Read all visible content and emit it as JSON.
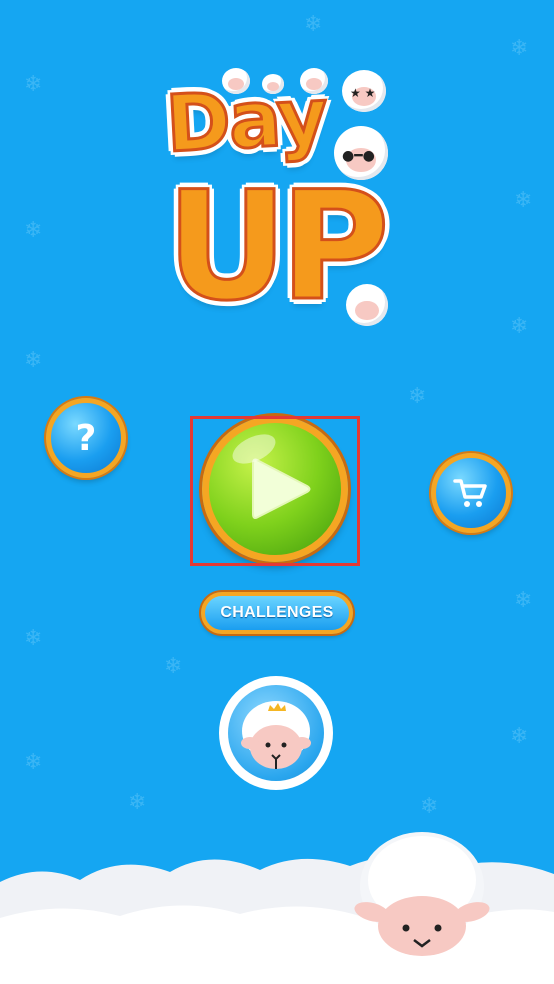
{
  "logo": {
    "line1": "Day",
    "line2": "UP"
  },
  "buttons": {
    "help_glyph": "?",
    "challenges_label": "CHALLENGES"
  },
  "colors": {
    "background": "#15a6f2",
    "button_rim": "#f5a623",
    "play_green": "#7fd11c",
    "highlight_box": "#e53935"
  },
  "icons": [
    "snowflake-icon",
    "help-icon",
    "play-icon",
    "cart-icon",
    "sheep-avatar-icon",
    "sheep-mascot"
  ]
}
